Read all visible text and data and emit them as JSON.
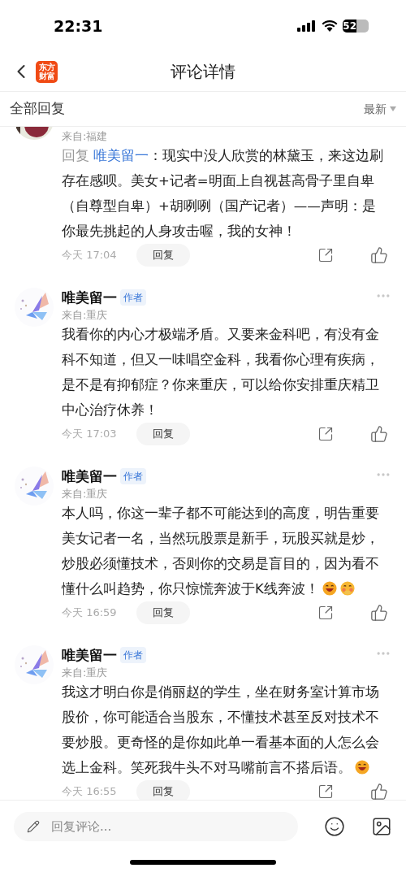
{
  "status_bar": {
    "time": "22:31",
    "battery": "52"
  },
  "header": {
    "logo": [
      "东方",
      "财富"
    ],
    "title": "评论详情"
  },
  "filter_bar": {
    "label": "全部回复",
    "sort": "最新"
  },
  "comments": [
    {
      "location": "来自:福建",
      "reply_label": "回复",
      "reply_to": "唯美留一",
      "text": "：现实中没人欣赏的林黛玉，来这边刷存在感呗。美女+记者=明面上自视甚高骨子里自卑（自尊型自卑）+胡咧咧（国产记者）——声明：是你最先挑起的人身攻击喔，我的女神！",
      "time": "今天 17:04",
      "reply_button": "回复"
    },
    {
      "name": "唯美留一",
      "badge": "作者",
      "location": "来自:重庆",
      "text": "我看你的内心才极端矛盾。又要来金科吧，有没有金科不知道，但又一味唱空金科，我看你心理有疾病，是不是有抑郁症？你来重庆，可以给你安排重庆精卫中心治疗休养！",
      "time": "今天 17:03",
      "reply_button": "回复"
    },
    {
      "name": "唯美留一",
      "badge": "作者",
      "location": "来自:重庆",
      "text": "本人吗，你这一辈子都不可能达到的高度，明告重要美女记者一名，当然玩股票是新手，玩股买就是炒，炒股必须懂技术，否则你的交易是盲目的，因为看不懂什么叫趋势，你只惊慌奔波于K线奔波！",
      "emoji": [
        {
          "kind": "grin"
        },
        {
          "kind": "shy"
        }
      ],
      "time": "今天 16:59",
      "reply_button": "回复"
    },
    {
      "name": "唯美留一",
      "badge": "作者",
      "location": "来自:重庆",
      "text": "我这才明白你是俏丽赵的学生，坐在财务室计算市场股价，你可能适合当股东，不懂技术甚至反对技术不要炒股。更奇怪的是你如此单一看基本面的人怎么会选上金科。笑死我牛头不对马嘴前言不搭后语。",
      "emoji": [
        {
          "kind": "grin"
        }
      ],
      "time": "今天 16:55",
      "reply_button": "回复"
    }
  ],
  "composer": {
    "placeholder": "回复评论..."
  }
}
